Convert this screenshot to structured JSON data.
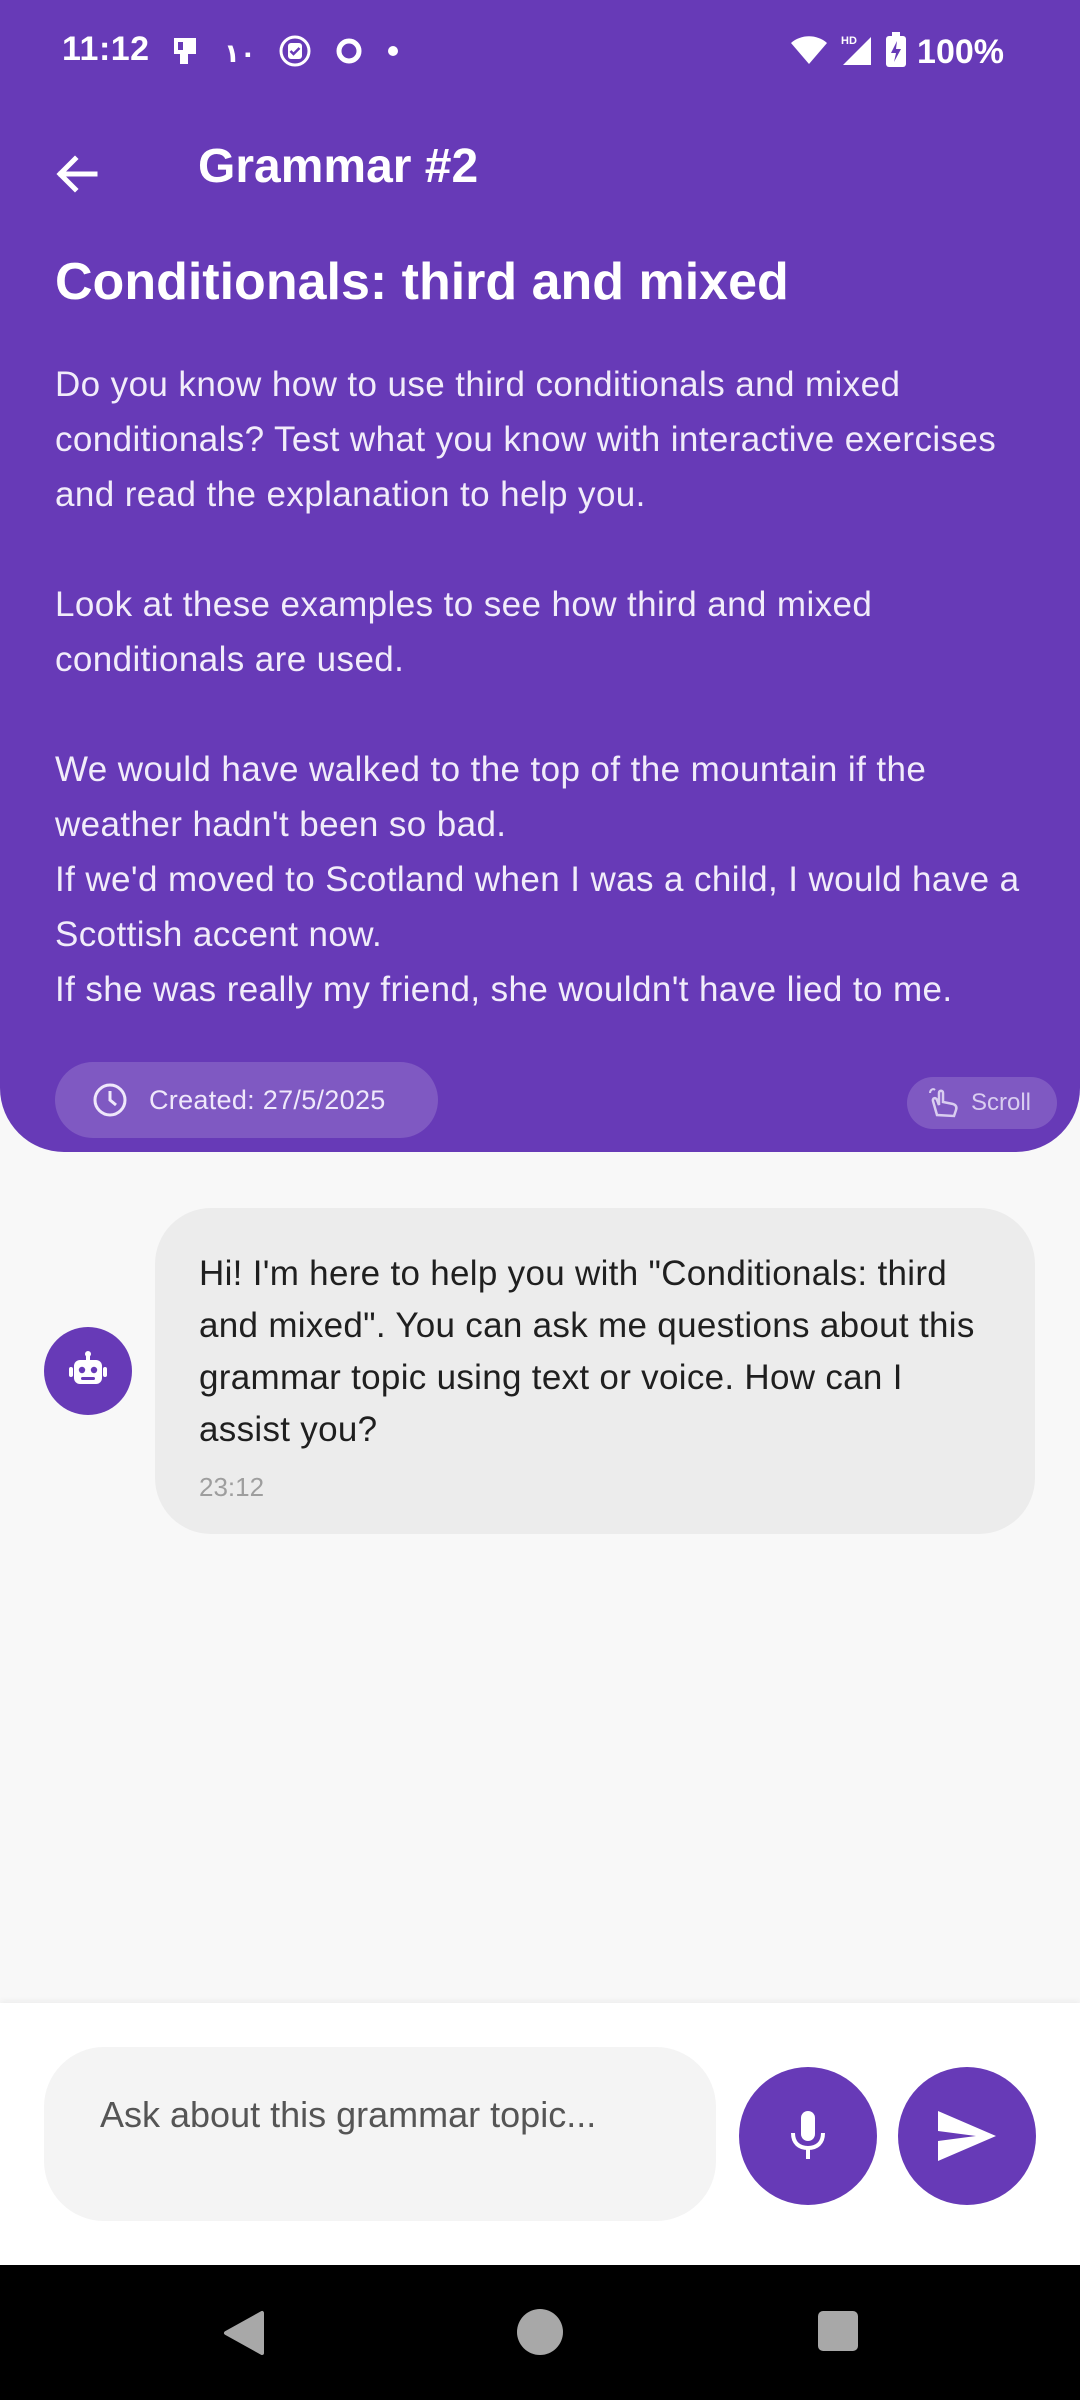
{
  "status_bar": {
    "time": "11:12",
    "battery": "100%",
    "notification_icons": [
      "sim-card-icon",
      "arabic-numeral-icon",
      "badge-check-icon",
      "circle-icon",
      "dot-icon"
    ],
    "system_icons": [
      "wifi-icon",
      "signal-hd-icon",
      "battery-charging-icon"
    ]
  },
  "appbar": {
    "title": "Grammar #2"
  },
  "lesson": {
    "title": "Conditionals: third and mixed",
    "intro": "Do you know how to use third conditionals and mixed conditionals? Test what you know with interactive exercises and read the explanation to help you.",
    "examples_intro": "Look at these examples to see how third and mixed conditionals are used.",
    "examples": [
      "We would have walked to the top of the mountain if the weather hadn't been so bad.",
      "If we'd moved to Scotland when I was a child, I would have a Scottish accent now.",
      "If she was really my friend, she wouldn't have lied to me."
    ],
    "created_label": "Created: 27/5/2025",
    "scroll_label": "Scroll"
  },
  "chat": {
    "messages": [
      {
        "sender": "bot",
        "text": "Hi! I'm here to help you with \"Conditionals: third and mixed\". You can ask me questions about this grammar topic using text or voice. How can I assist you?",
        "time": "23:12"
      }
    ]
  },
  "composer": {
    "placeholder": "Ask about this grammar topic...",
    "value": ""
  },
  "colors": {
    "primary": "#673ab7",
    "bubble": "#ececec",
    "background": "#f8f8f8"
  }
}
